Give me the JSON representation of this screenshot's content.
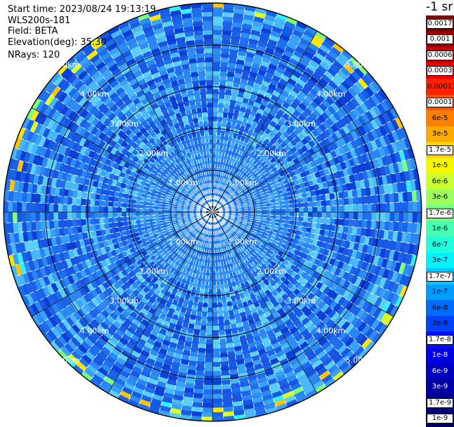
{
  "header": {
    "start_time": "Start time: 2023/08/24 19:13:19",
    "instrument": "WLS200s-181",
    "field": "Field: BETA",
    "elevation": "Elevation(deg): 35.30",
    "nrays": "NRays: 120"
  },
  "colorbar": {
    "units": "-1 sr",
    "labels": [
      "0.0017",
      "0.001",
      "0.0006",
      "0.0003",
      "0.00017",
      "0.0001",
      "6e-5",
      "3e-5",
      "1.7e-5",
      "1e-5",
      "6e-6",
      "3e-6",
      "1.7e-6",
      "1e-6",
      "6e-7",
      "3e-7",
      "1.7e-7",
      "1e-7",
      "6e-8",
      "3e-8",
      "1.7e-8",
      "1e-8",
      "6e-9",
      "3e-9",
      "1.7e-9",
      "1e-9"
    ],
    "colors": [
      "#7f0000",
      "#a40000",
      "#c80000",
      "#ee0000",
      "#ff2200",
      "#ff5500",
      "#ff7f00",
      "#ffaa00",
      "#ffd200",
      "#f4f700",
      "#c8ff2e",
      "#9cff5b",
      "#70ff87",
      "#44ffb3",
      "#1dffde",
      "#00f4ff",
      "#00c8ff",
      "#009cff",
      "#006cff",
      "#0040ff",
      "#0010ff",
      "#0000e2",
      "#0000c4",
      "#0000a6",
      "#000086",
      "#000068"
    ],
    "text_light": [
      "0.0017",
      "0.001",
      "0.0006",
      "0.0003",
      "1.7e-8",
      "1e-8",
      "6e-9",
      "3e-9",
      "1.7e-9",
      "1e-9"
    ],
    "boxed": [
      "0.0017",
      "0.001",
      "0.0006",
      "0.0003",
      "0.0001",
      "1.7e-5",
      "1.7e-6",
      "1.7e-7",
      "1.7e-8",
      "1.7e-9",
      "1e-9"
    ]
  },
  "chart_data": {
    "type": "heatmap",
    "projection": "polar-ppi",
    "field": "BETA",
    "elevation_deg": 35.3,
    "rays": 120,
    "range_rings": [
      {
        "label": "1.00km"
      },
      {
        "label": "2.00km"
      },
      {
        "label": "3.00km"
      },
      {
        "label": "4.00km"
      },
      {
        "label": "5.00km"
      }
    ],
    "grid": true
  }
}
